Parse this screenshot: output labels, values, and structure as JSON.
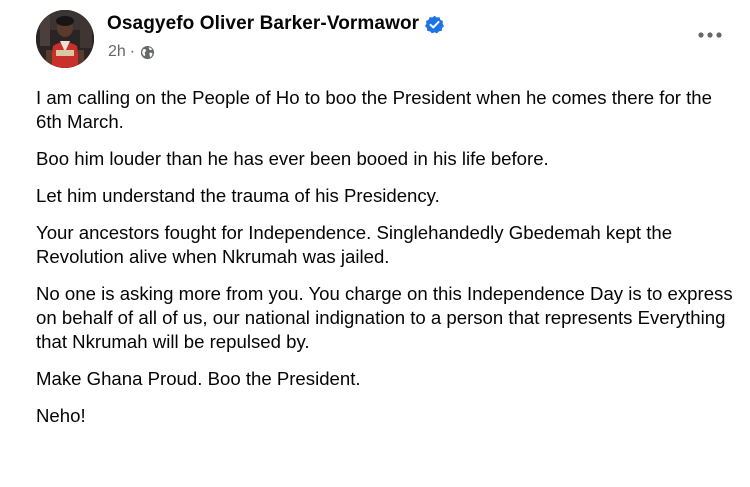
{
  "post": {
    "author": "Osagyefo Oliver Barker-Vormawor",
    "timestamp": "2h",
    "separator": "·",
    "privacy_icon": "globe-icon",
    "verified_icon": "verified-badge-icon",
    "more_icon": "more-options-icon",
    "paragraphs": [
      "I am calling on the People of Ho to boo the President when he comes there for the 6th March.",
      "Boo him louder than he has ever been booed in his life before.",
      "Let him understand the trauma of his Presidency.",
      "Your ancestors fought for Independence. Singlehandedly Gbedemah kept the Revolution alive when Nkrumah was jailed.",
      "No one is asking more from you. You charge on this Independence Day is to express on behalf of all of us, our national indignation to a person that represents Everything that Nkrumah will be repulsed by.",
      "Make Ghana Proud. Boo the President.",
      "Neho!"
    ]
  },
  "colors": {
    "text": "#050505",
    "secondary_text": "#65676b",
    "verified_blue": "#1b74e4",
    "background": "#ffffff"
  }
}
